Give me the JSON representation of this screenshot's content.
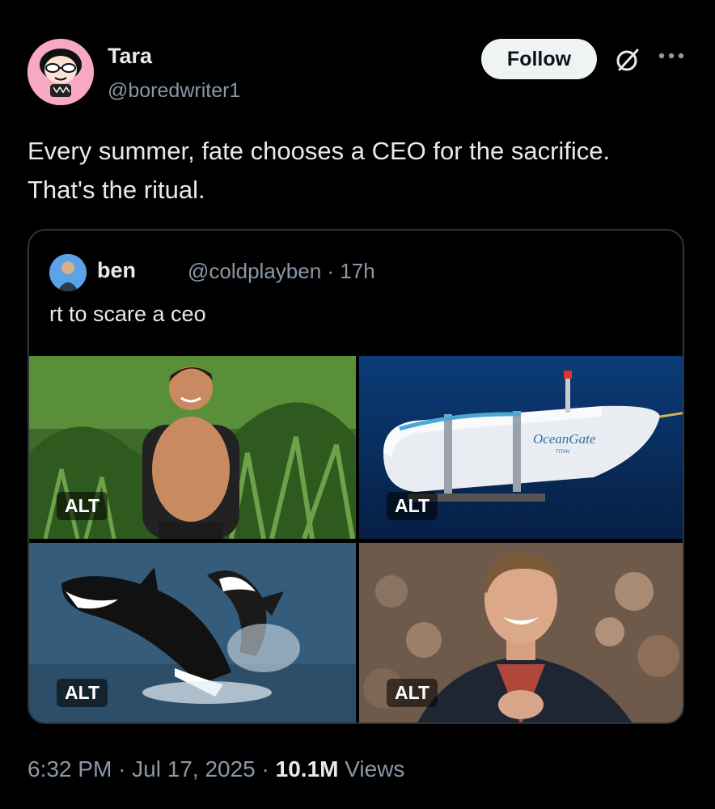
{
  "author": {
    "name": "Tara",
    "handle": "@boredwriter1",
    "follow_label": "Follow"
  },
  "tweet": {
    "text": "Every summer, fate chooses a CEO for the sacrifice. That's the ritual."
  },
  "quoted": {
    "name": "ben",
    "handle": "@coldplayben",
    "separator": "·",
    "time": "17h",
    "text": "rt to scare a ceo",
    "media": [
      {
        "alt_label": "ALT",
        "icon": "hiker-photo"
      },
      {
        "alt_label": "ALT",
        "icon": "submarine-photo",
        "brand_text": "OceanGate",
        "brand_sub": "TITAN"
      },
      {
        "alt_label": "ALT",
        "icon": "orca-photo"
      },
      {
        "alt_label": "ALT",
        "icon": "singer-photo"
      }
    ]
  },
  "footer": {
    "time": "6:32 PM",
    "date": "Jul 17, 2025",
    "views_count": "10.1M",
    "views_label": "Views",
    "separator": "·"
  },
  "colors": {
    "background": "#000000",
    "text": "#e7e9ea",
    "secondary": "#8b98a5",
    "border": "#2f3336",
    "follow_bg": "#eff3f4"
  }
}
